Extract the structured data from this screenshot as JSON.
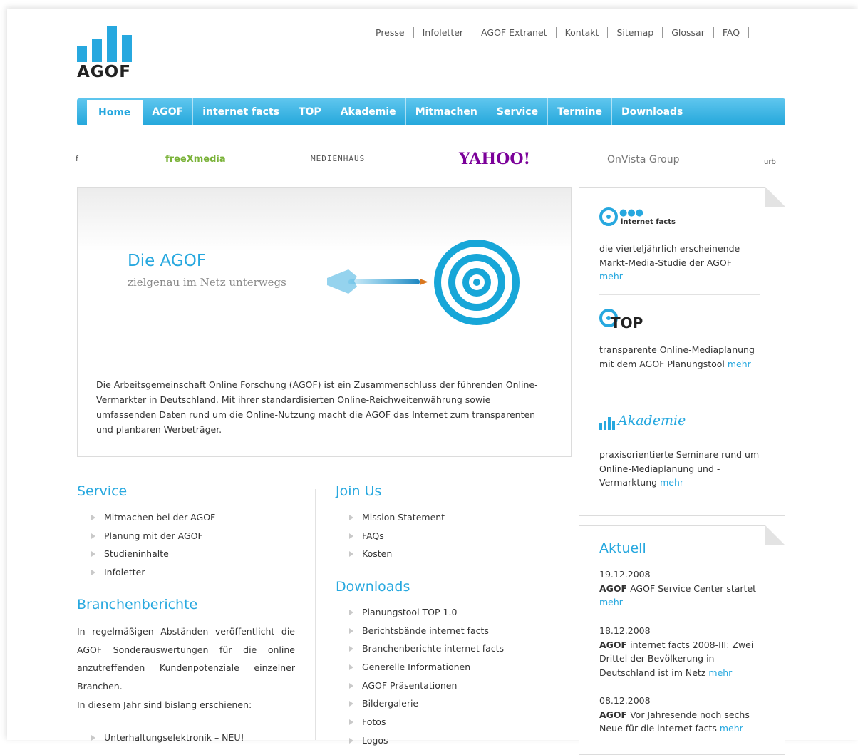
{
  "top_links": [
    "Presse",
    "Infoletter",
    "AGOF Extranet",
    "Kontakt",
    "Sitemap",
    "Glossar",
    "FAQ"
  ],
  "logo": {
    "text": "AGOF"
  },
  "nav": [
    "Home",
    "AGOF",
    "internet facts",
    "TOP",
    "Akademie",
    "Mitmachen",
    "Service",
    "Termine",
    "Downloads"
  ],
  "partner_logos": [
    "freeXmedia",
    "MEDIENHAUS",
    "YAHOO!",
    "OnVista Group"
  ],
  "hero": {
    "title": "Die AGOF",
    "subtitle": "zielgenau im Netz unterwegs",
    "text": "Die Arbeitsgemeinschaft Online Forschung (AGOF) ist ein Zusammenschluss der führenden Online-Vermarkter in Deutschland. Mit ihrer standardisierten Online-Reichweitenwährung sowie umfassenden Daten rund um die Online-Nutzung macht die AGOF das Internet zum transparenten und planbaren Werbeträger."
  },
  "sidebar": {
    "internet_facts": {
      "logo": "internet facts",
      "text": "die vierteljährlich erscheinende Markt-Media-Studie der AGOF",
      "more": "mehr"
    },
    "top": {
      "logo": "TOP",
      "text": "transparente Online-Mediaplanung mit dem AGOF Planungstool",
      "more": "mehr"
    },
    "akademie": {
      "logo": "Akademie",
      "text": "praxisorientierte Seminare rund um Online-Mediaplanung und -Vermarktung",
      "more": "mehr"
    }
  },
  "aktuell": {
    "heading": "Aktuell",
    "items": [
      {
        "date": "19.12.2008",
        "bold": "AGOF",
        "text": "AGOF Service Center startet",
        "more": "mehr"
      },
      {
        "date": "18.12.2008",
        "bold": "AGOF",
        "text": "internet facts 2008-III: Zwei Drittel der Bevölkerung in Deutschland ist im Netz",
        "more": "mehr"
      },
      {
        "date": "08.12.2008",
        "bold": "AGOF",
        "text": "Vor Jahresende noch sechs Neue für die internet facts",
        "more": "mehr"
      }
    ]
  },
  "service": {
    "heading": "Service",
    "items": [
      "Mitmachen bei der AGOF",
      "Planung mit der AGOF",
      "Studieninhalte",
      "Infoletter"
    ]
  },
  "branchenberichte": {
    "heading": "Branchenberichte",
    "text": "In regelmäßigen Abständen veröffentlicht die AGOF Sonderauswertungen für die online anzutreffenden Kundenpotenziale einzelner Branchen.",
    "text2": "In diesem Jahr sind bislang erschienen:",
    "items": [
      "Unterhaltungselektronik – NEU!"
    ]
  },
  "join_us": {
    "heading": "Join Us",
    "items": [
      "Mission Statement",
      "FAQs",
      "Kosten"
    ]
  },
  "downloads": {
    "heading": "Downloads",
    "items": [
      "Planungstool TOP 1.0",
      "Berichtsbände internet facts",
      "Branchenberichte internet facts",
      "Generelle Informationen",
      "AGOF Präsentationen",
      "Bildergalerie",
      "Fotos",
      "Logos"
    ]
  },
  "colors": {
    "brand_blue": "#27a8df"
  }
}
